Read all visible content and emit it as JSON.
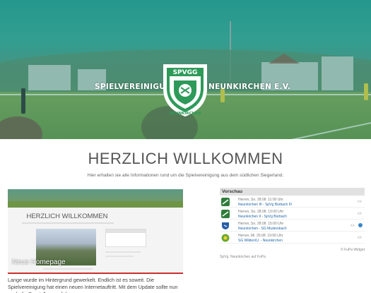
{
  "hero": {
    "club_left": "SPIELVEREINIGUNG",
    "club_right": "NEUNKIRCHEN E.V.",
    "crest_top": "SPVGG",
    "crest_bottom": "NEUNKIRCHEN",
    "colors": {
      "teal": "#2a9c92",
      "field": "#7d9a4f",
      "crest_green": "#2e9a5a"
    }
  },
  "welcome": {
    "title": "HERZLICH WILLKOMMEN",
    "subtitle": "Hier erhalten sie alle Informationen rund um die Spielvereinigung aus dem südlichen Siegerland."
  },
  "news": {
    "thumb_title": "HERZLICH WILLKOMMEN",
    "overlay": "Neue Homepage",
    "text": "Lange wurde im Hintergrund gewerkelt. Endlich ist es soweit. Die Spielvereinigung hat einen neuen Internetauftritt. Mit dem Update sollte nun auch die Darstellung auf dem",
    "accent": "#d22c2c"
  },
  "widget": {
    "heading": "Vorschau",
    "matches": [
      {
        "date": "Herren, So. 28.08. 11:00 Uhr",
        "teams": "Neunkirchen III - SpVg Bürbach III",
        "logo_color": "#2e7d3a",
        "arrow": "<>"
      },
      {
        "date": "Herren, So. 28.08. 13:00 Uhr",
        "teams": "Neunkirchen II - SpVg Bürbach",
        "logo_color": "#2e7d3a",
        "arrow": "<>"
      },
      {
        "date": "Herren, So. 28.08. 15:00 Uhr",
        "teams": "Neunkirchen - SG Mudersbach",
        "logo_color": "#2a5fa8",
        "arrow": "<>"
      },
      {
        "date": "Herren, Mi. 29.08. 19:00 Uhr",
        "teams": "SG Wilden/U. - Neunkirchen",
        "logo_color": "#6aa832",
        "arrow": "<>"
      }
    ],
    "credit": "© FuPa Widget",
    "link": "SpVg. Neunkirchen auf FuPa"
  }
}
